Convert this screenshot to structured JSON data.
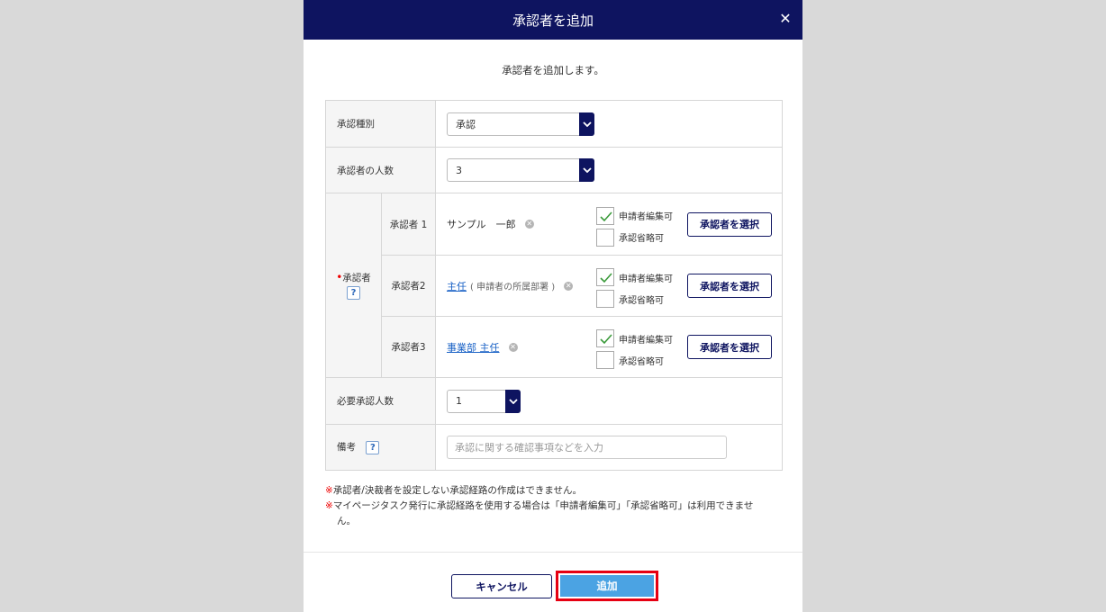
{
  "dialog": {
    "title": "承認者を追加",
    "intro": "承認者を追加します。"
  },
  "icons": {
    "close": "close-icon",
    "dropdown": "chevron-down-icon",
    "clear": "clear-icon",
    "check": "check-icon",
    "help": "help-icon"
  },
  "colors": {
    "header": "#0e1460",
    "primary_button": "#4ba3e3",
    "link": "#1a62c6",
    "highlight": "#e60012"
  },
  "form": {
    "approval_type": {
      "label": "承認種別",
      "value": "承認"
    },
    "approver_count": {
      "label": "承認者の人数",
      "value": "3"
    },
    "approvers_label": "承認者",
    "help_mark": "?",
    "approvers": [
      {
        "label": "承認者 1",
        "name": "サンプル　一郎",
        "name_link": "",
        "name_sub": "",
        "editable_label": "申請者編集可",
        "editable": true,
        "skippable_label": "承認省略可",
        "skippable": false,
        "select_label": "承認者を選択"
      },
      {
        "label": "承認者2",
        "name": "",
        "name_link": "主任",
        "name_sub": "( 申請者の所属部署 )",
        "editable_label": "申請者編集可",
        "editable": true,
        "skippable_label": "承認省略可",
        "skippable": false,
        "select_label": "承認者を選択"
      },
      {
        "label": "承認者3",
        "name": "",
        "name_link": "事業部 主任",
        "name_sub": "",
        "editable_label": "申請者編集可",
        "editable": true,
        "skippable_label": "承認省略可",
        "skippable": false,
        "select_label": "承認者を選択"
      }
    ],
    "required_count": {
      "label": "必要承認人数",
      "value": "1"
    },
    "memo": {
      "label": "備考",
      "placeholder": "承認に関する確認事項などを入力"
    }
  },
  "notes": {
    "mark": "※",
    "line1": "承認者/決裁者を設定しない承認経路の作成はできません。",
    "line2": "マイページタスク発行に承認経路を使用する場合は「申請者編集可」「承認省略可」は利用できませ",
    "line2_cont": "ん。"
  },
  "footer": {
    "cancel_label": "キャンセル",
    "add_label": "追加"
  }
}
